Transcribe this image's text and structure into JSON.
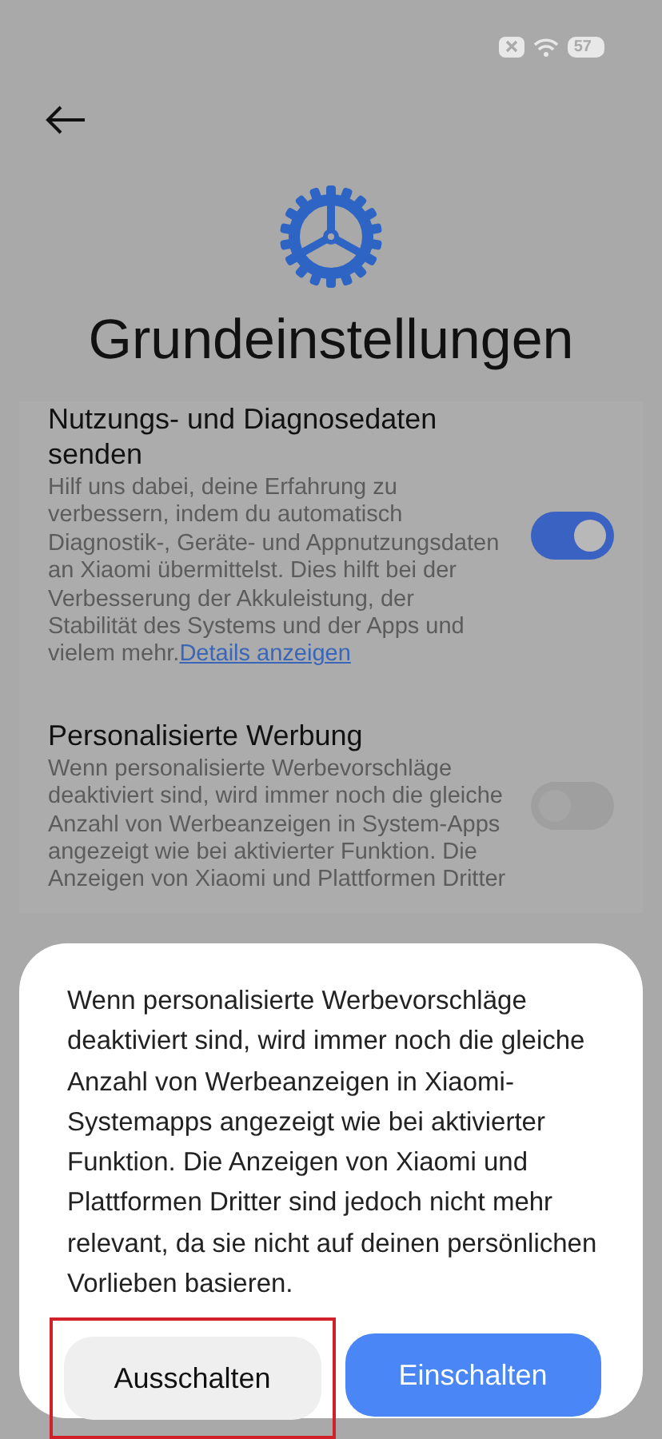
{
  "status_bar": {
    "battery": "57"
  },
  "header": {
    "title": "Grundeinstellungen"
  },
  "settings": [
    {
      "title": "Nutzungs- und Diagnosedaten senden",
      "description": "Hilf uns dabei, deine Erfahrung zu verbessern, indem du automatisch Diagnostik-, Geräte- und Appnutzungsdaten an Xiaomi übermittelst. Dies hilft bei der Verbesserung der Akkuleistung, der Stabilität des Systems und der Apps und vielem mehr.",
      "link": "Details anzeigen",
      "on": true
    },
    {
      "title": "Personalisierte Werbung",
      "description": "Wenn personalisierte Werbevorschläge deaktiviert sind, wird immer noch die gleiche Anzahl von Werbeanzeigen in System-Apps angezeigt wie bei aktivierter Funktion. Die Anzeigen von Xiaomi und Plattformen Dritter",
      "on": false
    }
  ],
  "dialog": {
    "message": "Wenn personalisierte Werbevorschläge deaktiviert sind, wird immer noch die gleiche Anzahl von Werbeanzeigen in Xiaomi-Systemapps angezeigt wie bei aktivierter Funktion. Die Anzeigen von Xiaomi und Plattformen Dritter sind jedoch nicht mehr relevant, da sie nicht auf deinen persönlichen Vorlieben basieren.",
    "buttons": [
      {
        "label": "Ausschalten",
        "kind": "secondary",
        "highlighted": true
      },
      {
        "label": "Einschalten",
        "kind": "primary",
        "highlighted": false
      }
    ]
  }
}
